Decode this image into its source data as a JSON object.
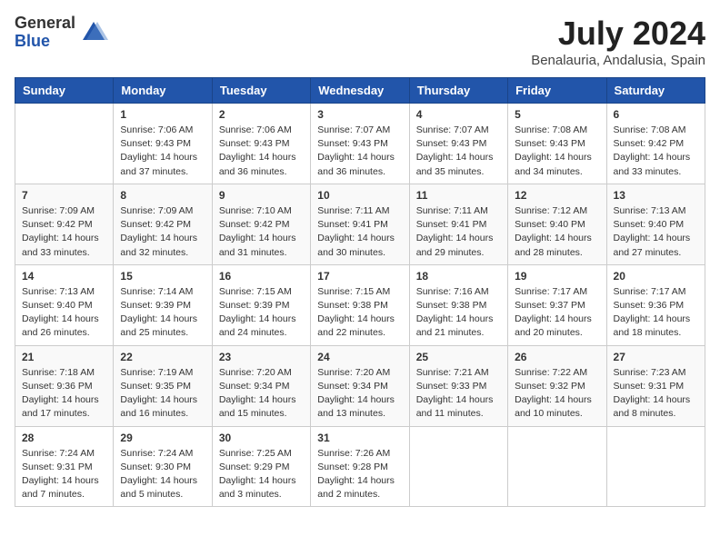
{
  "logo": {
    "general": "General",
    "blue": "Blue"
  },
  "title": "July 2024",
  "subtitle": "Benalauria, Andalusia, Spain",
  "days_of_week": [
    "Sunday",
    "Monday",
    "Tuesday",
    "Wednesday",
    "Thursday",
    "Friday",
    "Saturday"
  ],
  "weeks": [
    [
      {
        "day": "",
        "info": ""
      },
      {
        "day": "1",
        "info": "Sunrise: 7:06 AM\nSunset: 9:43 PM\nDaylight: 14 hours\nand 37 minutes."
      },
      {
        "day": "2",
        "info": "Sunrise: 7:06 AM\nSunset: 9:43 PM\nDaylight: 14 hours\nand 36 minutes."
      },
      {
        "day": "3",
        "info": "Sunrise: 7:07 AM\nSunset: 9:43 PM\nDaylight: 14 hours\nand 36 minutes."
      },
      {
        "day": "4",
        "info": "Sunrise: 7:07 AM\nSunset: 9:43 PM\nDaylight: 14 hours\nand 35 minutes."
      },
      {
        "day": "5",
        "info": "Sunrise: 7:08 AM\nSunset: 9:43 PM\nDaylight: 14 hours\nand 34 minutes."
      },
      {
        "day": "6",
        "info": "Sunrise: 7:08 AM\nSunset: 9:42 PM\nDaylight: 14 hours\nand 33 minutes."
      }
    ],
    [
      {
        "day": "7",
        "info": "Sunrise: 7:09 AM\nSunset: 9:42 PM\nDaylight: 14 hours\nand 33 minutes."
      },
      {
        "day": "8",
        "info": "Sunrise: 7:09 AM\nSunset: 9:42 PM\nDaylight: 14 hours\nand 32 minutes."
      },
      {
        "day": "9",
        "info": "Sunrise: 7:10 AM\nSunset: 9:42 PM\nDaylight: 14 hours\nand 31 minutes."
      },
      {
        "day": "10",
        "info": "Sunrise: 7:11 AM\nSunset: 9:41 PM\nDaylight: 14 hours\nand 30 minutes."
      },
      {
        "day": "11",
        "info": "Sunrise: 7:11 AM\nSunset: 9:41 PM\nDaylight: 14 hours\nand 29 minutes."
      },
      {
        "day": "12",
        "info": "Sunrise: 7:12 AM\nSunset: 9:40 PM\nDaylight: 14 hours\nand 28 minutes."
      },
      {
        "day": "13",
        "info": "Sunrise: 7:13 AM\nSunset: 9:40 PM\nDaylight: 14 hours\nand 27 minutes."
      }
    ],
    [
      {
        "day": "14",
        "info": "Sunrise: 7:13 AM\nSunset: 9:40 PM\nDaylight: 14 hours\nand 26 minutes."
      },
      {
        "day": "15",
        "info": "Sunrise: 7:14 AM\nSunset: 9:39 PM\nDaylight: 14 hours\nand 25 minutes."
      },
      {
        "day": "16",
        "info": "Sunrise: 7:15 AM\nSunset: 9:39 PM\nDaylight: 14 hours\nand 24 minutes."
      },
      {
        "day": "17",
        "info": "Sunrise: 7:15 AM\nSunset: 9:38 PM\nDaylight: 14 hours\nand 22 minutes."
      },
      {
        "day": "18",
        "info": "Sunrise: 7:16 AM\nSunset: 9:38 PM\nDaylight: 14 hours\nand 21 minutes."
      },
      {
        "day": "19",
        "info": "Sunrise: 7:17 AM\nSunset: 9:37 PM\nDaylight: 14 hours\nand 20 minutes."
      },
      {
        "day": "20",
        "info": "Sunrise: 7:17 AM\nSunset: 9:36 PM\nDaylight: 14 hours\nand 18 minutes."
      }
    ],
    [
      {
        "day": "21",
        "info": "Sunrise: 7:18 AM\nSunset: 9:36 PM\nDaylight: 14 hours\nand 17 minutes."
      },
      {
        "day": "22",
        "info": "Sunrise: 7:19 AM\nSunset: 9:35 PM\nDaylight: 14 hours\nand 16 minutes."
      },
      {
        "day": "23",
        "info": "Sunrise: 7:20 AM\nSunset: 9:34 PM\nDaylight: 14 hours\nand 15 minutes."
      },
      {
        "day": "24",
        "info": "Sunrise: 7:20 AM\nSunset: 9:34 PM\nDaylight: 14 hours\nand 13 minutes."
      },
      {
        "day": "25",
        "info": "Sunrise: 7:21 AM\nSunset: 9:33 PM\nDaylight: 14 hours\nand 11 minutes."
      },
      {
        "day": "26",
        "info": "Sunrise: 7:22 AM\nSunset: 9:32 PM\nDaylight: 14 hours\nand 10 minutes."
      },
      {
        "day": "27",
        "info": "Sunrise: 7:23 AM\nSunset: 9:31 PM\nDaylight: 14 hours\nand 8 minutes."
      }
    ],
    [
      {
        "day": "28",
        "info": "Sunrise: 7:24 AM\nSunset: 9:31 PM\nDaylight: 14 hours\nand 7 minutes."
      },
      {
        "day": "29",
        "info": "Sunrise: 7:24 AM\nSunset: 9:30 PM\nDaylight: 14 hours\nand 5 minutes."
      },
      {
        "day": "30",
        "info": "Sunrise: 7:25 AM\nSunset: 9:29 PM\nDaylight: 14 hours\nand 3 minutes."
      },
      {
        "day": "31",
        "info": "Sunrise: 7:26 AM\nSunset: 9:28 PM\nDaylight: 14 hours\nand 2 minutes."
      },
      {
        "day": "",
        "info": ""
      },
      {
        "day": "",
        "info": ""
      },
      {
        "day": "",
        "info": ""
      }
    ]
  ]
}
